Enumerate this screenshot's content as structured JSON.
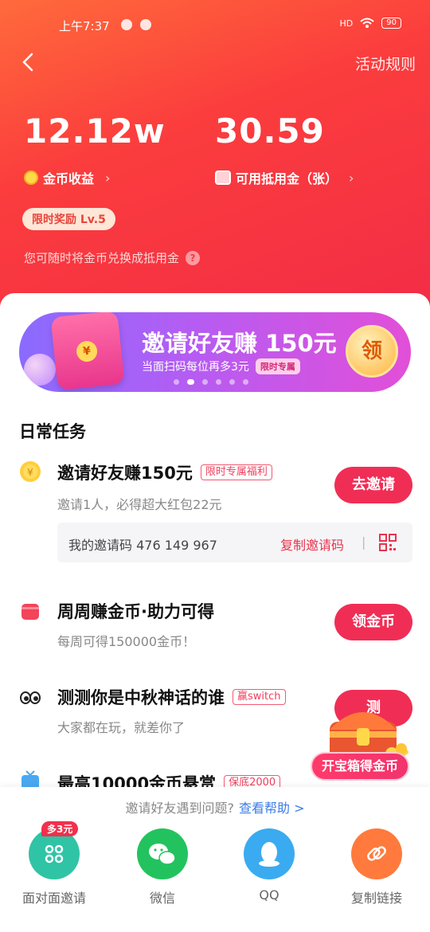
{
  "status_bar": {
    "time": "上午7:37",
    "network": "HD",
    "battery": "90"
  },
  "header": {
    "rules_label": "活动规则"
  },
  "stats": {
    "coins_value": "12.12w",
    "coins_label": "金币收益",
    "vouchers_value": "30.59",
    "vouchers_label": "可用抵用金（张）"
  },
  "reward_pill": "限时奖励 Lv.5",
  "tip_text": "您可随时将金币兑换成抵用金",
  "banner": {
    "title": "邀请好友赚 150元",
    "subtitle": "当面扫码每位再多3元",
    "tag": "限时专属",
    "button": "领",
    "dots": 6,
    "active_dot": 1
  },
  "section_title": "日常任务",
  "tasks": [
    {
      "title": "邀请好友赚150元",
      "tag": "限时专属福利",
      "desc": "邀请1人，必得超大红包22元",
      "button": "去邀请"
    },
    {
      "title": "周周赚金币·助力可得",
      "tag": "",
      "desc": "每周可得150000金币！",
      "button": "领金币"
    },
    {
      "title": "测测你是中秋神话的谁",
      "tag": "赢switch",
      "desc": "大家都在玩，就差你了",
      "button": "测"
    },
    {
      "title": "最高10000金币悬赏",
      "tag": "保底2000",
      "desc": "",
      "button": ""
    }
  ],
  "invite_code": {
    "label": "我的邀请码 476 149 967",
    "copy_label": "复制邀请码"
  },
  "chest_label": "开宝箱得金币",
  "help": {
    "text": "邀请好友遇到问题?",
    "link": "查看帮助 >"
  },
  "share": [
    {
      "label": "面对面邀请",
      "badge": "多3元",
      "color": "#2fc4a5"
    },
    {
      "label": "微信",
      "badge": "",
      "color": "#22c35e"
    },
    {
      "label": "QQ",
      "badge": "",
      "color": "#3aabf0"
    },
    {
      "label": "复制链接",
      "badge": "",
      "color": "#ff7a3c"
    }
  ]
}
